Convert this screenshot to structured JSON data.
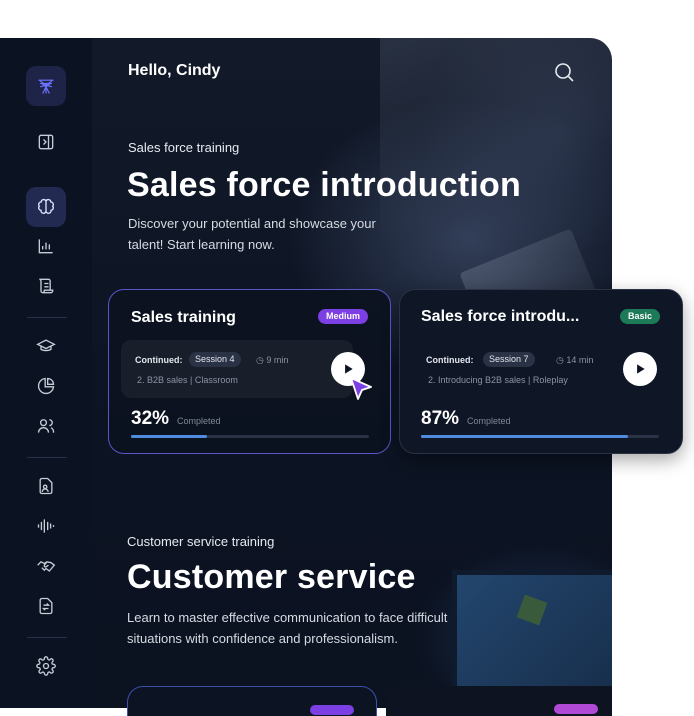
{
  "header": {
    "greeting": "Hello, Cindy"
  },
  "sections": [
    {
      "eyebrow": "Sales force training",
      "title": "Sales force introduction",
      "description_line1": "Discover your potential and showcase your",
      "description_line2": "talent! Start learning now.",
      "cards": [
        {
          "title": "Sales training",
          "level": "Medium",
          "continued_label": "Continued:",
          "session": "Session 4",
          "duration": "9 min",
          "lesson": "2. B2B sales | Classroom",
          "progress_pct": "32%",
          "progress_value": 32,
          "completed_label": "Completed"
        },
        {
          "title": "Sales force introdu...",
          "level": "Basic",
          "continued_label": "Continued:",
          "session": "Session 7",
          "duration": "14 min",
          "lesson": "2. Introducing B2B sales | Roleplay",
          "progress_pct": "87%",
          "progress_value": 87,
          "completed_label": "Completed"
        }
      ]
    },
    {
      "eyebrow": "Customer service training",
      "title": "Customer service",
      "description_line1": "Learn to master effective communication to face difficult",
      "description_line2": "situations with confidence and professionalism."
    }
  ],
  "sidebar": {
    "icons": [
      "logo-icon",
      "collapse-sidebar-icon",
      "brain-icon",
      "bar-chart-icon",
      "scroll-icon",
      "graduation-cap-icon",
      "pie-chart-icon",
      "users-icon",
      "document-user-icon",
      "audio-wave-icon",
      "handshake-icon",
      "document-transfer-icon",
      "settings-icon"
    ]
  },
  "colors": {
    "accent": "#7b3fe4",
    "basic_badge": "#1d7a58",
    "progress": "#4f8ce0",
    "card_border_active": "#5a55c9",
    "background": "#0c1322"
  }
}
